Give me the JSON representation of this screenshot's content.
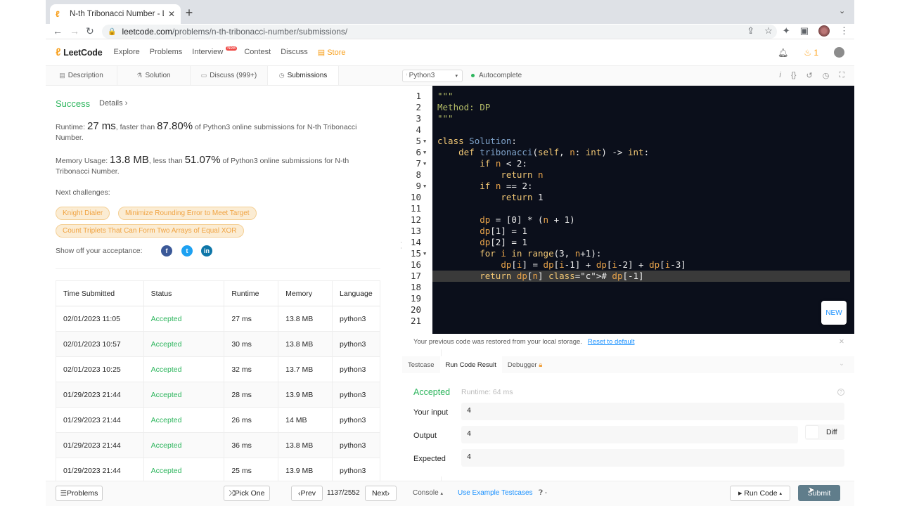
{
  "browser": {
    "tab_title": "N-th Tribonacci Number - Leet",
    "url_host": "leetcode.com",
    "url_path": "/problems/n-th-tribonacci-number/submissions/"
  },
  "nav": {
    "logo": "LeetCode",
    "links": [
      "Explore",
      "Problems",
      "Interview",
      "Contest",
      "Discuss",
      "Store"
    ],
    "interview_badge": "New",
    "streak": "1"
  },
  "left_tabs": [
    "Description",
    "Solution",
    "Discuss (999+)",
    "Submissions"
  ],
  "result": {
    "status": "Success",
    "details": "Details",
    "runtime_pre": "Runtime:",
    "runtime": "27 ms",
    "runtime_mid": ", faster than",
    "runtime_pct": "87.80%",
    "runtime_post": "of Python3 online submissions for N-th Tribonacci Number.",
    "mem_pre": "Memory Usage:",
    "mem": "13.8 MB",
    "mem_mid": ", less than",
    "mem_pct": "51.07%",
    "mem_post": "of Python3 online submissions for N-th Tribonacci Number.",
    "next_label": "Next challenges:",
    "challenges": [
      "Knight Dialer",
      "Minimize Rounding Error to Meet Target",
      "Count Triplets That Can Form Two Arrays of Equal XOR"
    ],
    "share_label": "Show off your acceptance:"
  },
  "table": {
    "headers": [
      "Time Submitted",
      "Status",
      "Runtime",
      "Memory",
      "Language"
    ],
    "rows": [
      [
        "02/01/2023 11:05",
        "Accepted",
        "27 ms",
        "13.8 MB",
        "python3"
      ],
      [
        "02/01/2023 10:57",
        "Accepted",
        "30 ms",
        "13.8 MB",
        "python3"
      ],
      [
        "02/01/2023 10:25",
        "Accepted",
        "32 ms",
        "13.7 MB",
        "python3"
      ],
      [
        "01/29/2023 21:44",
        "Accepted",
        "28 ms",
        "13.9 MB",
        "python3"
      ],
      [
        "01/29/2023 21:44",
        "Accepted",
        "26 ms",
        "14 MB",
        "python3"
      ],
      [
        "01/29/2023 21:44",
        "Accepted",
        "36 ms",
        "13.8 MB",
        "python3"
      ],
      [
        "01/29/2023 21:44",
        "Accepted",
        "25 ms",
        "13.9 MB",
        "python3"
      ]
    ]
  },
  "editor": {
    "language": "Python3",
    "autocomplete": "Autocomplete",
    "line_numbers": [
      "1",
      "2",
      "3",
      "4",
      "5",
      "6",
      "7",
      "8",
      "9",
      "10",
      "11",
      "12",
      "13",
      "14",
      "15",
      "16",
      "17",
      "18",
      "19",
      "20",
      "21"
    ],
    "lines": [
      "\"\"\"",
      "Method: DP",
      "\"\"\"",
      "",
      "class Solution:",
      "    def tribonacci(self, n: int) -> int:",
      "        if n < 2:",
      "            return n",
      "        if n == 2:",
      "            return 1",
      "",
      "        dp = [0] * (n + 1)",
      "        dp[1] = 1",
      "        dp[2] = 1",
      "        for i in range(3, n+1):",
      "            dp[i] = dp[i-1] + dp[i-2] + dp[i-3]",
      "        return dp[n] # dp[-1]",
      "",
      "",
      "",
      ""
    ],
    "new_label": "NEW"
  },
  "restore": {
    "msg": "Your previous code was restored from your local storage.",
    "reset": "Reset to default"
  },
  "bottom_tabs": [
    "Testcase",
    "Run Code Result",
    "Debugger"
  ],
  "run_result": {
    "status": "Accepted",
    "runtime": "Runtime: 64 ms",
    "input_label": "Your input",
    "input": "4",
    "output_label": "Output",
    "output": "4",
    "expected_label": "Expected",
    "expected": "4",
    "diff": "Diff"
  },
  "footer": {
    "problems": "Problems",
    "pick": "Pick One",
    "prev": "Prev",
    "count": "1137/2552",
    "next": "Next",
    "console": "Console",
    "examples": "Use Example Testcases",
    "run": "Run Code",
    "submit": "Submit"
  },
  "colors": {
    "accent": "#ffa116",
    "success": "#2db55d",
    "link": "#1890ff",
    "editor_bg": "#0b0f1b"
  }
}
